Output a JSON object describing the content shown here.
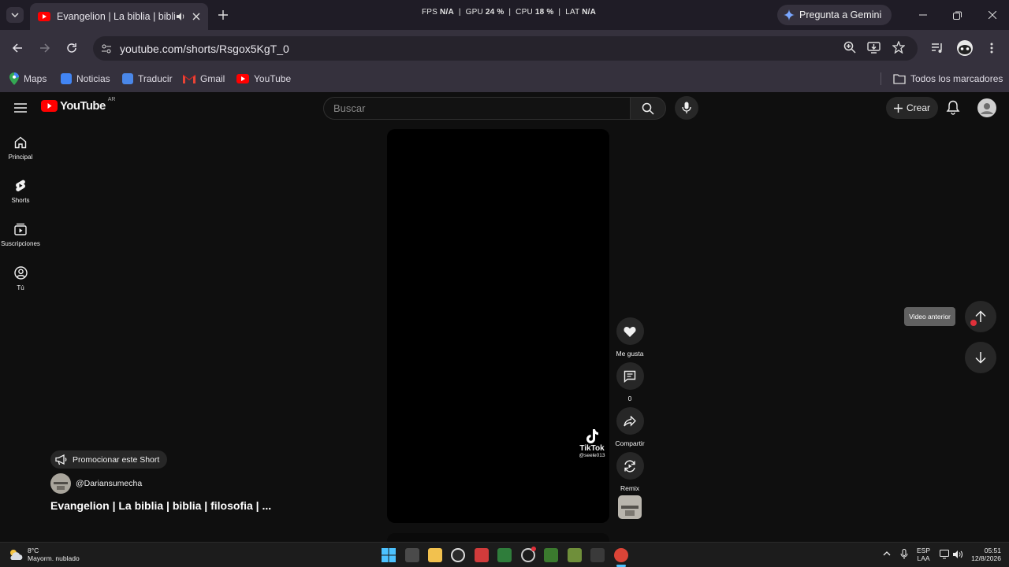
{
  "browser": {
    "tab_title": "Evangelion | La biblia | biblia",
    "hud": {
      "fps_label": "FPS",
      "fps_value": "N/A",
      "gpu_label": "GPU",
      "gpu_value": "24 %",
      "cpu_label": "CPU",
      "cpu_value": "18 %",
      "lat_label": "LAT",
      "lat_value": "N/A"
    },
    "gemini_label": "Pregunta a Gemini",
    "url": "youtube.com/shorts/Rsgox5KgT_0",
    "bookmarks": [
      "Maps",
      "Noticias",
      "Traducir",
      "Gmail",
      "YouTube"
    ],
    "all_bookmarks_label": "Todos los marcadores"
  },
  "youtube": {
    "logo_text": "YouTube",
    "country_code": "AR",
    "search_placeholder": "Buscar",
    "create_label": "Crear",
    "guide": [
      "Principal",
      "Shorts",
      "Suscripciones",
      "Tú"
    ],
    "actions": {
      "like_label": "Me gusta",
      "comments_count": "0",
      "share_label": "Compartir",
      "remix_label": "Remix"
    },
    "watermark": {
      "brand": "TikTok",
      "handle": "@seele013"
    },
    "tooltip": "Video anterior",
    "promote_label": "Promocionar este Short",
    "channel_handle": "@Dariansumecha",
    "short_title": "Evangelion | La biblia | biblia | filosofia | ..."
  },
  "taskbar": {
    "weather_temp": "8°C",
    "weather_desc": "Mayorm. nublado",
    "lang_top": "ESP",
    "lang_bottom": "LAA",
    "time": "05:51",
    "date": "12/8/2026"
  },
  "colors": {
    "youtube_red": "#ff0000",
    "page_bg": "#0f0f0f",
    "chrome_frame": "#35313d"
  }
}
